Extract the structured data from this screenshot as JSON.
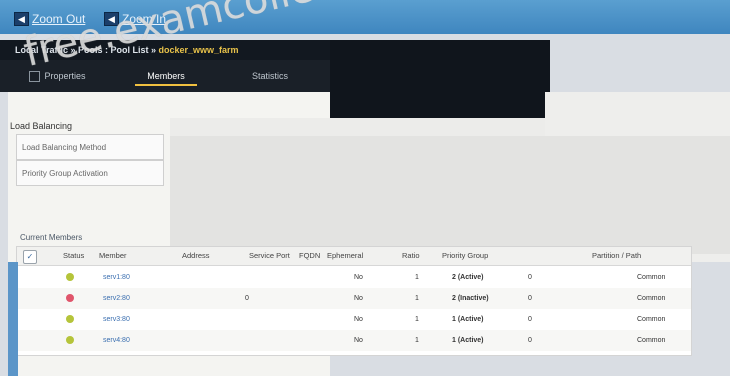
{
  "toolbar": {
    "zoom_out_label": "Zoom Out",
    "zoom_in_label": "Zoom In"
  },
  "breadcrumb": {
    "path": "Local Traffic » Pools : Pool List » ",
    "current": "docker_www_farm"
  },
  "tabs": [
    {
      "label": "Properties",
      "active": false
    },
    {
      "label": "Members",
      "active": true
    },
    {
      "label": "Statistics",
      "active": false
    }
  ],
  "load_balancing": {
    "title": "Load Balancing",
    "method_label": "Load Balancing Method",
    "priority_label": "Priority Group Activation"
  },
  "members_section": {
    "title": "Current Members"
  },
  "table": {
    "columns": [
      "Status",
      "Member",
      "Address",
      "Service Port",
      "FQDN",
      "Ephemeral",
      "Ratio",
      "Priority Group",
      "Partition / Path"
    ],
    "rows": [
      {
        "status": "green",
        "member": "serv1:80",
        "address": "",
        "port": "",
        "ephemeral": "No",
        "ratio": "1",
        "priority": "2 (Active)",
        "conn": "0",
        "partition": "Common"
      },
      {
        "status": "red",
        "member": "serv2:80",
        "address": "",
        "port": "0",
        "ephemeral": "No",
        "ratio": "1",
        "priority": "2 (Inactive)",
        "conn": "0",
        "partition": "Common"
      },
      {
        "status": "green",
        "member": "serv3:80",
        "address": "",
        "port": "",
        "ephemeral": "No",
        "ratio": "1",
        "priority": "1 (Active)",
        "conn": "0",
        "partition": "Common"
      },
      {
        "status": "green",
        "member": "serv4:80",
        "address": "",
        "port": "",
        "ephemeral": "No",
        "ratio": "1",
        "priority": "1 (Active)",
        "conn": "0",
        "partition": "Common"
      }
    ]
  },
  "watermark": "free.examcollectionpass.com",
  "colors": {
    "status_green": "#b5c43a",
    "status_red": "#e0556b",
    "accent_tab": "#f0c040",
    "breadcrumb_current": "#e8c24a"
  }
}
